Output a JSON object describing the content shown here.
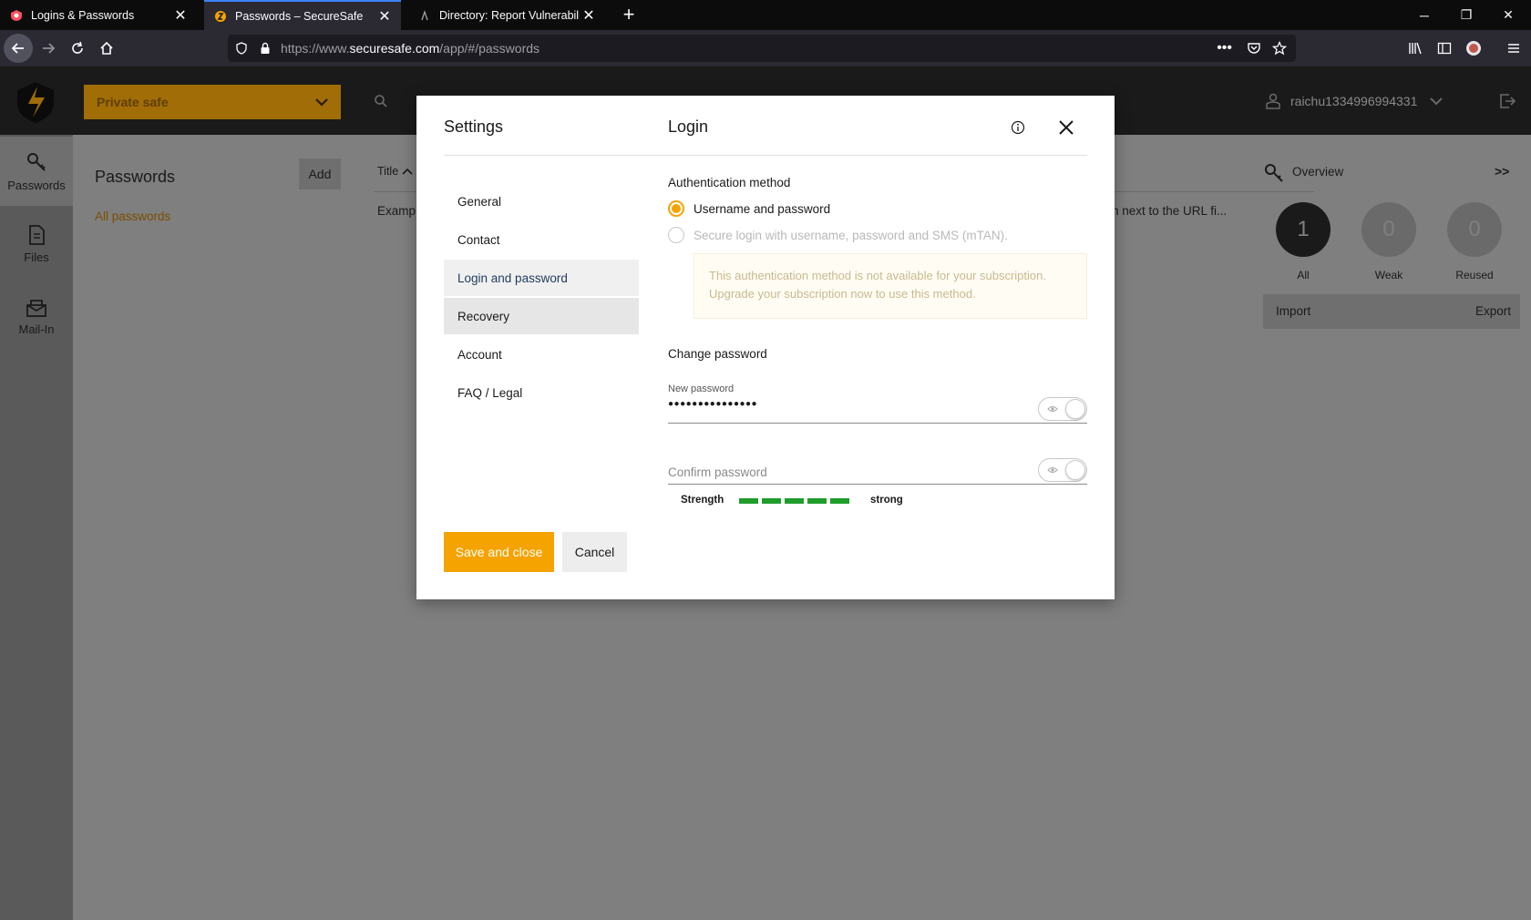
{
  "browser": {
    "tabs": [
      {
        "title": "Logins & Passwords",
        "active": false
      },
      {
        "title": "Passwords – SecureSafe",
        "active": true
      },
      {
        "title": "Directory: Report Vulnerabilities",
        "active": false
      }
    ],
    "new_tab": "+",
    "url": {
      "prefix": "https://www.",
      "domain": "securesafe.com",
      "path": "/app/#/passwords"
    },
    "accent_color": "#3b82f6"
  },
  "header": {
    "safe_select": "Private safe",
    "username": "raichu1334996994331",
    "brand_color": "#f5a300"
  },
  "sidebar": {
    "items": [
      {
        "label": "Passwords",
        "icon": "key-icon"
      },
      {
        "label": "Files",
        "icon": "file-icon"
      },
      {
        "label": "Mail-In",
        "icon": "mail-icon"
      }
    ]
  },
  "passwords_panel": {
    "title": "Passwords",
    "add_label": "Add",
    "filter_all": "All passwords",
    "column_title": "Title",
    "row_title_fragment": "Examp",
    "row_note_fragment": "n next to the URL fi..."
  },
  "overview": {
    "title": "Overview",
    "expand": ">>",
    "stats": [
      {
        "value": "1",
        "label": "All"
      },
      {
        "value": "0",
        "label": "Weak"
      },
      {
        "value": "0",
        "label": "Reused"
      }
    ],
    "import_label": "Import",
    "export_label": "Export"
  },
  "modal": {
    "title": "Settings",
    "section_title": "Login",
    "menu": [
      {
        "label": "General"
      },
      {
        "label": "Contact"
      },
      {
        "label": "Login and password"
      },
      {
        "label": "Recovery"
      },
      {
        "label": "Account"
      },
      {
        "label": "FAQ / Legal"
      }
    ],
    "auth": {
      "heading": "Authentication method",
      "option_password": "Username and password",
      "option_mtan": "Secure login with username, password and SMS (mTAN).",
      "note": "This authentication method is not available for your subscription. Upgrade your subscription now to use this method."
    },
    "change_password": {
      "heading": "Change password",
      "new_label": "New password",
      "new_value": "●●●●●●●●●●●●●●●",
      "confirm_placeholder": "Confirm password",
      "strength_label": "Strength",
      "strength_value": "strong",
      "strength_color": "#1f9d2b"
    },
    "save_label": "Save and close",
    "cancel_label": "Cancel"
  }
}
